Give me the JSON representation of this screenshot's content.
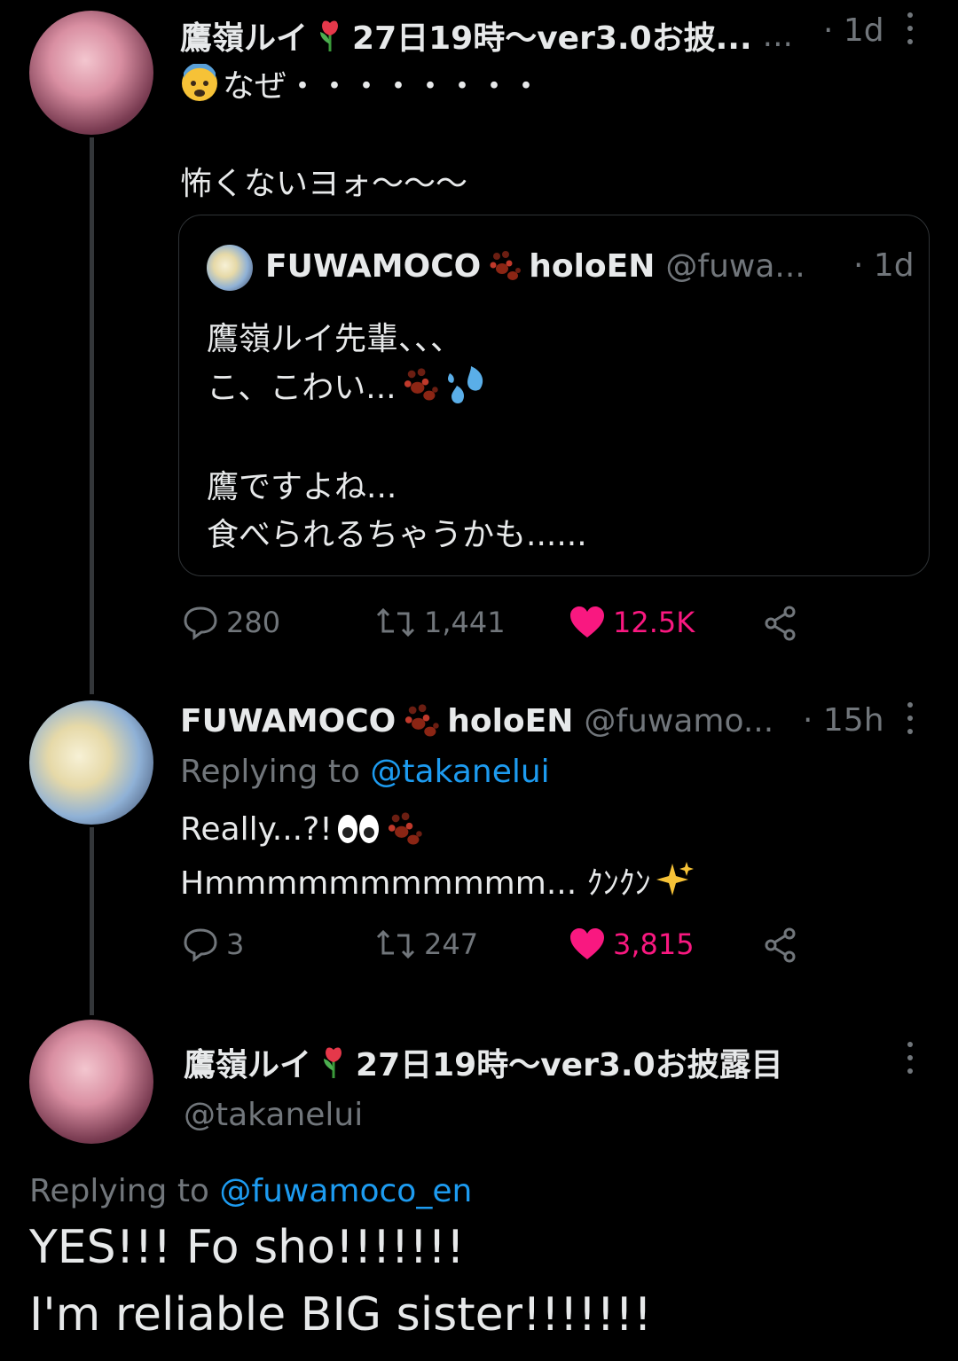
{
  "tweet1": {
    "name": "鷹嶺ルイ",
    "name_suffix": "27日19時〜ver3.0お披...",
    "ellipsis": "...",
    "time": "· 1d",
    "line1": "なぜ・・・・・・・・",
    "line2": "怖くないヨォ〜〜〜",
    "quote": {
      "name": "FUWAMOCO",
      "name_suffix": "holoEN",
      "handle": "@fuwa...",
      "time": "· 1d",
      "lines": [
        "鷹嶺ルイ先輩、、、",
        "こ、こわい...",
        "鷹ですよね...",
        "食べられるちゃうかも......"
      ]
    },
    "actions": {
      "replies": "280",
      "retweets": "1,441",
      "likes": "12.5K"
    }
  },
  "tweet2": {
    "name": "FUWAMOCO",
    "name_suffix": "holoEN",
    "handle": "@fuwamo...",
    "time": "· 15h",
    "replying_label": "Replying to",
    "replying_to": "@takanelui",
    "line1": "Really...?! ",
    "line2": "Hmmmmmmmmmmm... ｸﾝｸﾝ",
    "actions": {
      "replies": "3",
      "retweets": "247",
      "likes": "3,815"
    }
  },
  "tweet3": {
    "name": "鷹嶺ルイ",
    "name_suffix": "27日19時〜ver3.0お披露目",
    "handle": "@takanelui",
    "replying_label": "Replying to",
    "replying_to": "@fuwamoco_en",
    "line1": "YES!!! Fo sho!!!!!!!",
    "line2": "I'm reliable BIG sister!!!!!!!"
  },
  "colors": {
    "like": "#f91880",
    "link": "#1d9bf0",
    "muted": "#71767b"
  }
}
